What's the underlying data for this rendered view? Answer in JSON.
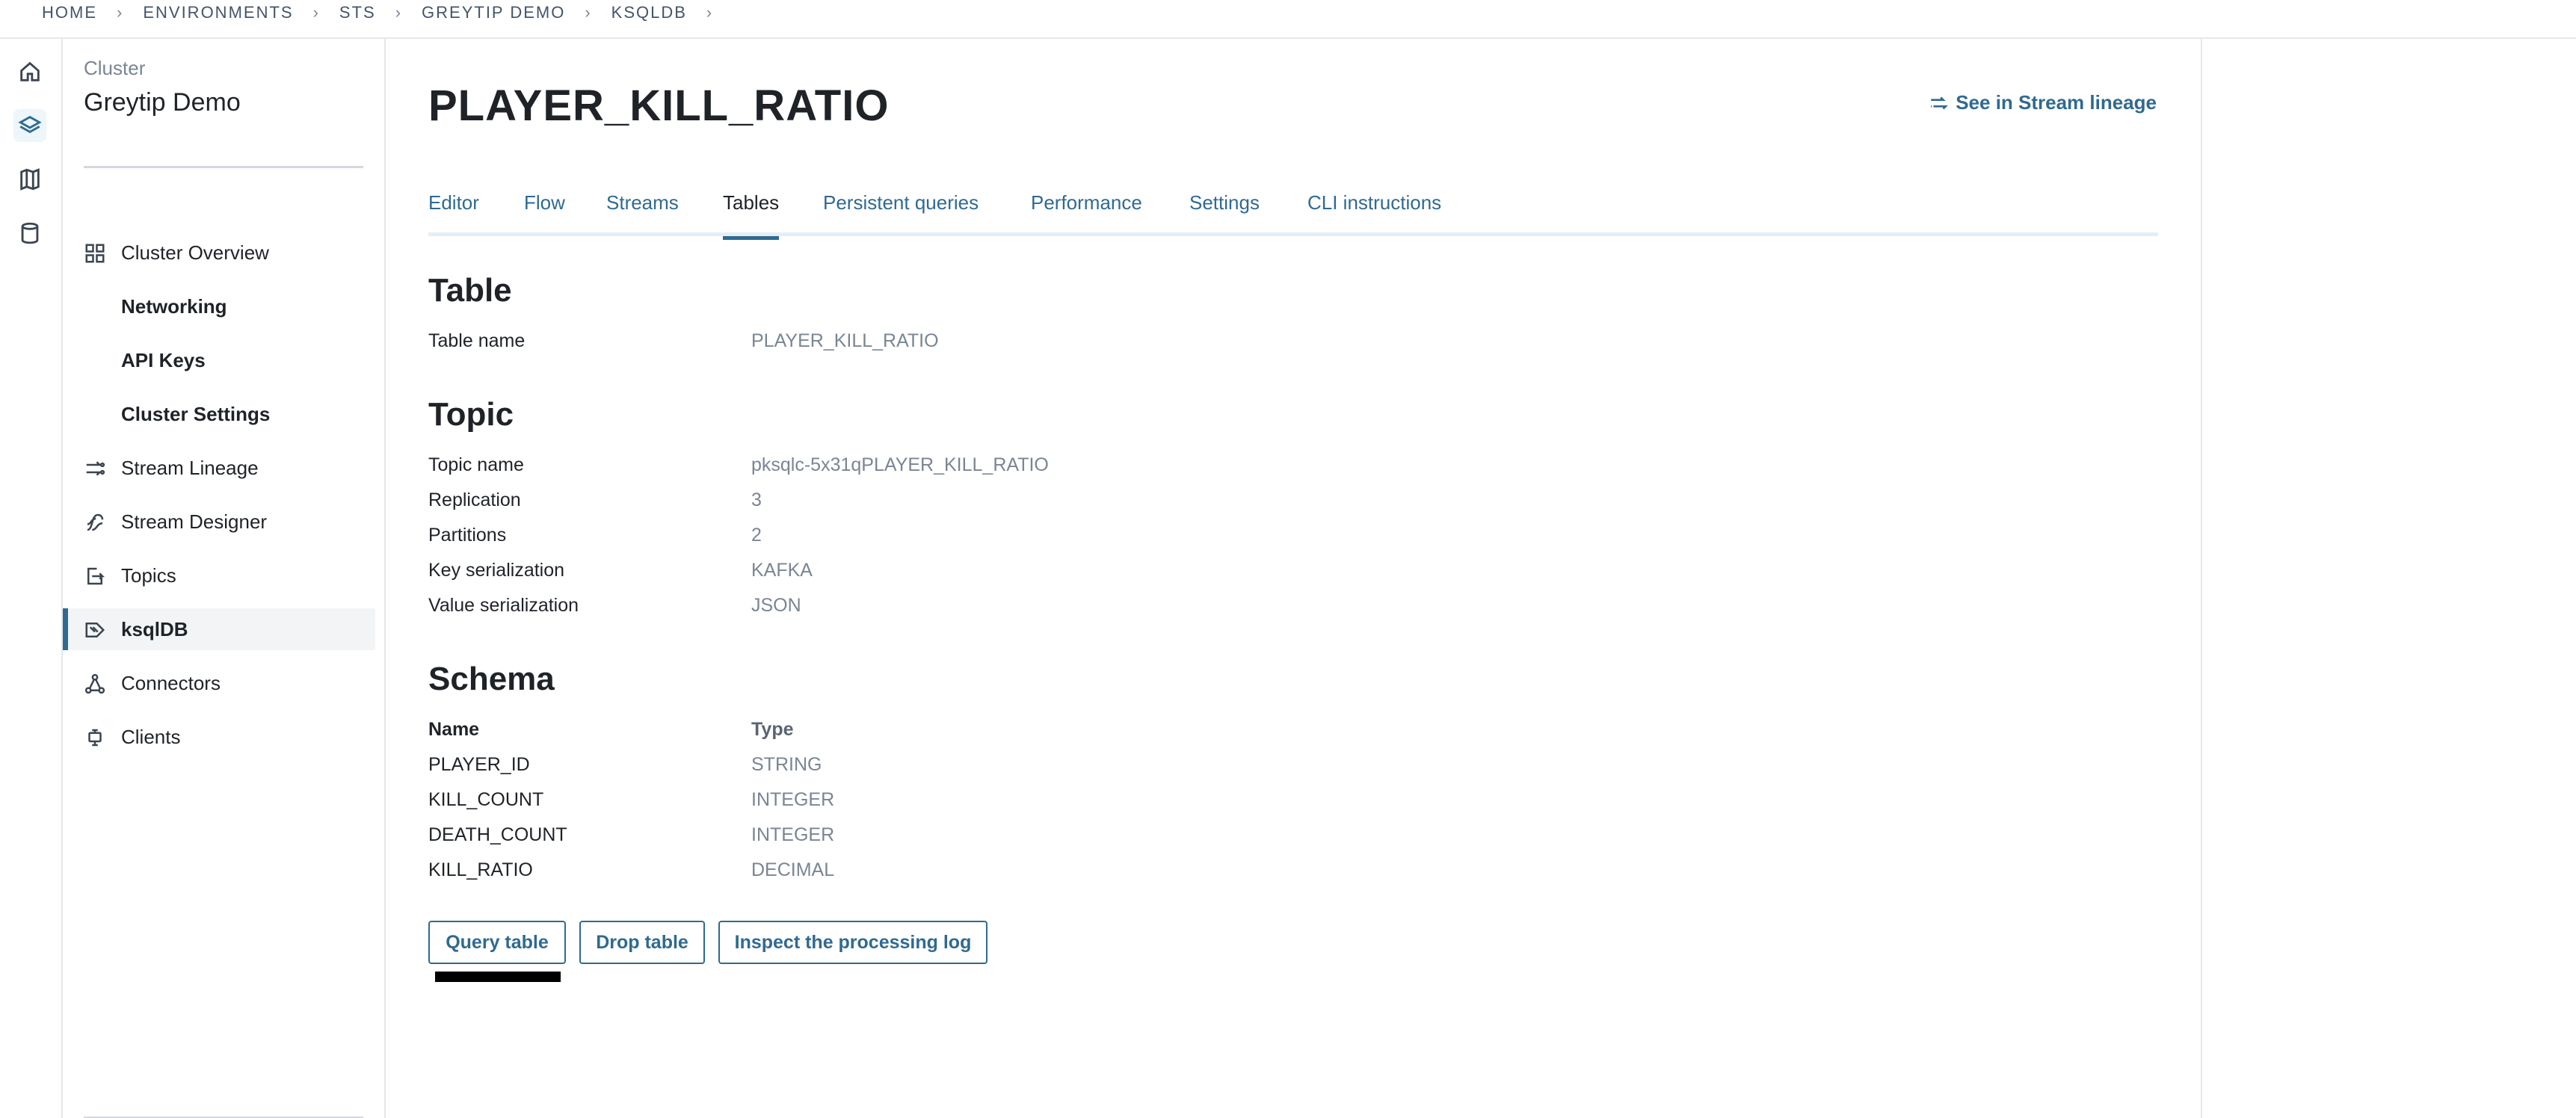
{
  "breadcrumb": [
    "HOME",
    "ENVIRONMENTS",
    "STS",
    "GREYTIP DEMO",
    "KSQLDB"
  ],
  "rail": {
    "items": [
      {
        "icon": "home-icon"
      },
      {
        "icon": "layers-icon",
        "active": true
      },
      {
        "icon": "map-icon"
      },
      {
        "icon": "database-icon"
      }
    ]
  },
  "sidebar": {
    "label": "Cluster",
    "title": "Greytip Demo",
    "items": [
      {
        "label": "Cluster Overview",
        "icon": "grid-icon"
      },
      {
        "label": "Networking"
      },
      {
        "label": "API Keys"
      },
      {
        "label": "Cluster Settings"
      },
      {
        "label": "Stream Lineage",
        "icon": "lineage-icon"
      },
      {
        "label": "Stream Designer",
        "icon": "stream-designer-icon"
      },
      {
        "label": "Topics",
        "icon": "topic-icon"
      },
      {
        "label": "ksqlDB",
        "icon": "ksqldb-icon",
        "active": true
      },
      {
        "label": "Connectors",
        "icon": "connector-icon"
      },
      {
        "label": "Clients",
        "icon": "client-icon"
      }
    ]
  },
  "main": {
    "title": "PLAYER_KILL_RATIO",
    "lineage_link": "See in Stream lineage",
    "tabs": [
      {
        "label": "Editor"
      },
      {
        "label": "Flow"
      },
      {
        "label": "Streams"
      },
      {
        "label": "Tables",
        "active": true
      },
      {
        "label": "Persistent queries"
      },
      {
        "label": "Performance"
      },
      {
        "label": "Settings"
      },
      {
        "label": "CLI instructions"
      }
    ],
    "table_section": {
      "heading": "Table",
      "rows": [
        {
          "label": "Table name",
          "value": "PLAYER_KILL_RATIO"
        }
      ]
    },
    "topic_section": {
      "heading": "Topic",
      "rows": [
        {
          "label": "Topic name",
          "value": "pksqlc-5x31qPLAYER_KILL_RATIO"
        },
        {
          "label": "Replication",
          "value": "3"
        },
        {
          "label": "Partitions",
          "value": "2"
        },
        {
          "label": "Key serialization",
          "value": "KAFKA"
        },
        {
          "label": "Value serialization",
          "value": "JSON"
        }
      ]
    },
    "schema_section": {
      "heading": "Schema",
      "columns": [
        "Name",
        "Type"
      ],
      "rows": [
        {
          "name": "PLAYER_ID",
          "type": "STRING"
        },
        {
          "name": "KILL_COUNT",
          "type": "INTEGER"
        },
        {
          "name": "DEATH_COUNT",
          "type": "INTEGER"
        },
        {
          "name": "KILL_RATIO",
          "type": "DECIMAL"
        }
      ]
    },
    "actions": {
      "query": "Query table",
      "drop": "Drop table",
      "inspect": "Inspect the processing log"
    }
  },
  "colors": {
    "accent": "#2f6a92",
    "muted_text": "#7a8594",
    "text": "#1f2328"
  }
}
